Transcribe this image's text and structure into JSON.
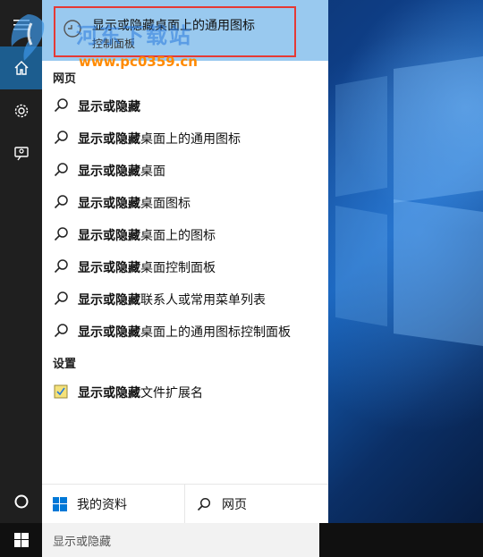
{
  "best_match": {
    "title": "显示或隐藏桌面上的通用图标",
    "subtitle": "控制面板"
  },
  "sections": {
    "web": "网页",
    "settings": "设置"
  },
  "web_results": [
    {
      "bold": "显示或隐藏",
      "rest": ""
    },
    {
      "bold": "显示或隐藏",
      "rest": "桌面上的通用图标"
    },
    {
      "bold": "显示或隐藏",
      "rest": "桌面"
    },
    {
      "bold": "显示或隐藏",
      "rest": "桌面图标"
    },
    {
      "bold": "显示或隐藏",
      "rest": "桌面上的图标"
    },
    {
      "bold": "显示或隐藏",
      "rest": "桌面控制面板"
    },
    {
      "bold": "显示或隐藏",
      "rest": "联系人或常用菜单列表"
    },
    {
      "bold": "显示或隐藏",
      "rest": "桌面上的通用图标控制面板"
    }
  ],
  "settings_results": [
    {
      "bold": "显示或隐藏",
      "rest": "文件扩展名"
    }
  ],
  "bottom_tabs": {
    "my_stuff": "我的资料",
    "web": "网页"
  },
  "search": {
    "value": "显示或隐藏"
  },
  "watermark": {
    "text": "河东下载站",
    "url": "www.pc0359.cn"
  },
  "colors": {
    "accent": "#1c5d8f",
    "best_match_bg": "#99c9ef",
    "highlight": "#e53935",
    "watermark_url": "#ff8a00"
  },
  "icons": {
    "menu": "hamburger-icon",
    "home": "home-icon",
    "settings": "gear-icon",
    "feedback": "feedback-icon",
    "cortana": "cortana-circle-icon",
    "search": "search-icon",
    "windows": "windows-logo-icon"
  }
}
